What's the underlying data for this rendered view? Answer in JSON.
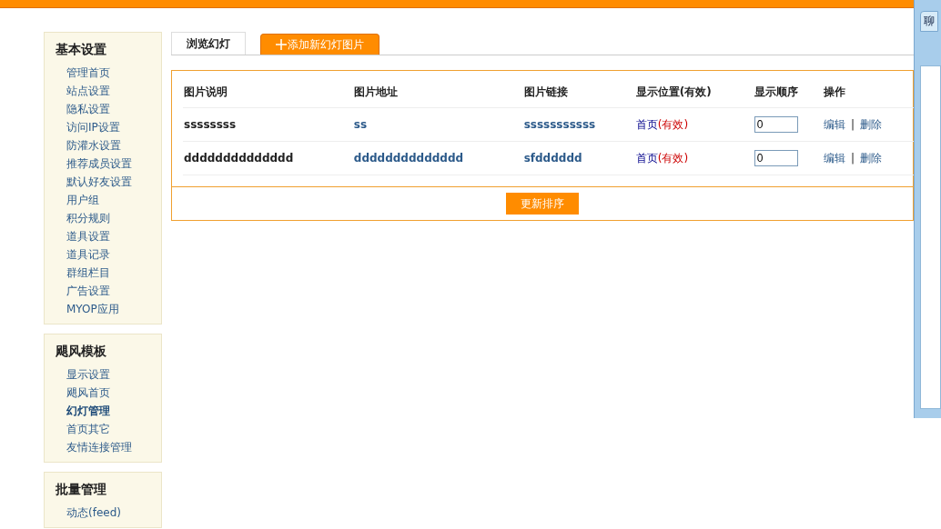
{
  "sidebar": [
    {
      "title": "基本设置",
      "items": [
        {
          "label": "管理首页",
          "selected": false
        },
        {
          "label": "站点设置",
          "selected": false
        },
        {
          "label": "隐私设置",
          "selected": false
        },
        {
          "label": "访问IP设置",
          "selected": false
        },
        {
          "label": "防灌水设置",
          "selected": false
        },
        {
          "label": "推荐成员设置",
          "selected": false
        },
        {
          "label": "默认好友设置",
          "selected": false
        },
        {
          "label": "用户组",
          "selected": false
        },
        {
          "label": "积分规则",
          "selected": false
        },
        {
          "label": "道具设置",
          "selected": false
        },
        {
          "label": "道具记录",
          "selected": false
        },
        {
          "label": "群组栏目",
          "selected": false
        },
        {
          "label": "广告设置",
          "selected": false
        },
        {
          "label": "MYOP应用",
          "selected": false
        }
      ]
    },
    {
      "title": "飓风模板",
      "items": [
        {
          "label": "显示设置",
          "selected": false
        },
        {
          "label": "飓风首页",
          "selected": false
        },
        {
          "label": "幻灯管理",
          "selected": true
        },
        {
          "label": "首页其它",
          "selected": false
        },
        {
          "label": "友情连接管理",
          "selected": false
        }
      ]
    },
    {
      "title": "批量管理",
      "items": [
        {
          "label": "动态(feed)",
          "selected": false
        }
      ]
    }
  ],
  "tabs": [
    {
      "label": "浏览幻灯",
      "selected": true,
      "kind": "plain"
    },
    {
      "label": "添加新幻灯图片",
      "selected": false,
      "kind": "add"
    }
  ],
  "table": {
    "columns": [
      "图片说明",
      "图片地址",
      "图片链接",
      "显示位置(有效)",
      "显示顺序",
      "操作"
    ],
    "rows": [
      {
        "description": "ssssssss",
        "address": "ss",
        "link": "sssssssssss",
        "position": "首页",
        "position_status": "(有效)",
        "order": "0",
        "edit": "编辑",
        "separator": "|",
        "delete": "删除"
      },
      {
        "description": "dddddddddddddd",
        "address": "dddddddddddddd",
        "link": "sfdddddd",
        "position": "首页",
        "position_status": "(有效)",
        "order": "0",
        "edit": "编辑",
        "separator": "|",
        "delete": "删除"
      }
    ]
  },
  "update_button": "更新排序",
  "chat_panel": {
    "tab": "聊"
  }
}
